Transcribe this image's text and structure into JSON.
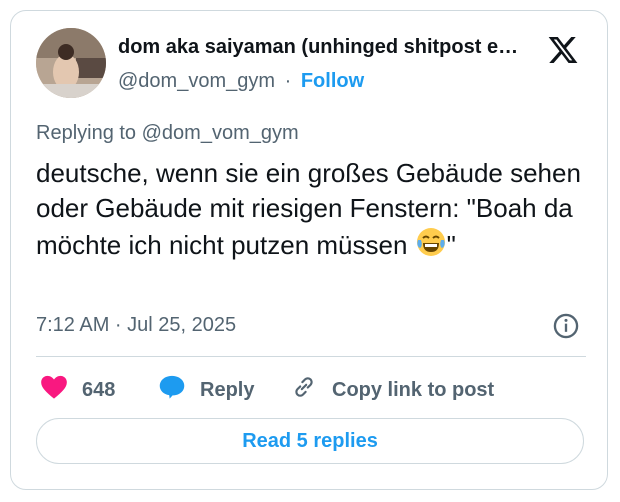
{
  "author": {
    "display_name": "dom aka saiyaman (unhinged shitpost e…",
    "handle": "@dom_vom_gym",
    "separator": "·",
    "follow_label": "Follow",
    "avatar_icon": "profile-photo"
  },
  "replying_to": "Replying to @dom_vom_gym",
  "tweet": {
    "text": "deutsche, wenn sie ein großes Gebäude sehen oder Gebäude mit riesigen Fenstern: \"Boah da möchte ich nicht putzen müssen ",
    "emoji": "😂",
    "text_end": "\""
  },
  "timestamp": "7:12 AM · Jul 25, 2025",
  "actions": {
    "likes": "648",
    "reply_label": "Reply",
    "copy_label": "Copy link to post"
  },
  "read_replies_label": "Read 5 replies",
  "colors": {
    "accent": "#1d9bf0",
    "like": "#f91880",
    "secondary_text": "#536471",
    "border": "#cfd9de"
  },
  "icons": [
    "x-logo-icon",
    "info-icon",
    "heart-icon",
    "reply-bubble-icon",
    "link-icon"
  ]
}
